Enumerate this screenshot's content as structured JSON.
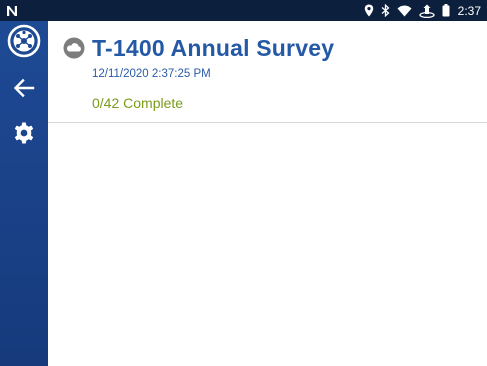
{
  "status_bar": {
    "time": "2:37",
    "icons": [
      "app-n-icon",
      "location-icon",
      "bluetooth-icon",
      "wifi-icon",
      "sync-icon",
      "battery-icon"
    ]
  },
  "sidebar": {
    "items": [
      {
        "name": "app-logo",
        "icon": "network-logo-icon"
      },
      {
        "name": "back",
        "icon": "arrow-left-icon"
      },
      {
        "name": "settings",
        "icon": "gear-icon"
      }
    ]
  },
  "survey": {
    "title": "T-1400 Annual Survey",
    "timestamp": "12/11/2020 2:37:25 PM",
    "progress_text": "0/42 Complete",
    "cloud_icon": "cloud-icon"
  },
  "colors": {
    "sidebar": "#1e4a95",
    "status_bar": "#0c1f3c",
    "title": "#2459a6",
    "progress": "#7a9b19"
  }
}
